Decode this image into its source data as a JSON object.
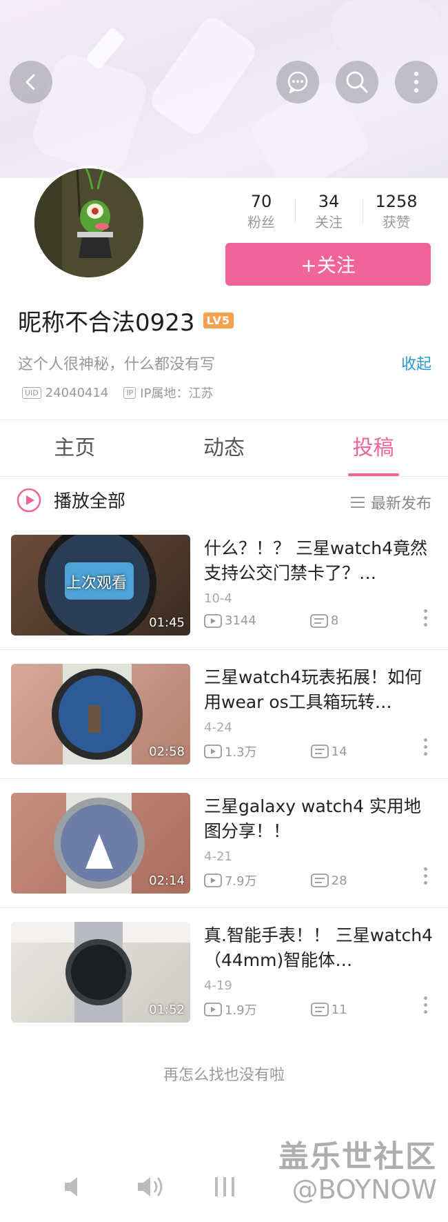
{
  "banner": {
    "back_icon": "back-arrow-icon",
    "message_icon": "chat-bubble-icon",
    "search_icon": "search-icon",
    "more_icon": "more-vertical-icon"
  },
  "profile": {
    "stats": [
      {
        "value": "70",
        "label": "粉丝"
      },
      {
        "value": "34",
        "label": "关注"
      },
      {
        "value": "1258",
        "label": "获赞"
      }
    ],
    "follow_label": "+关注",
    "nickname": "昵称不合法0923",
    "level": "LV5",
    "bio": "这个人很神秘，什么都没有写",
    "collapse_label": "收起",
    "uid_tag": "UID",
    "uid": "24040414",
    "ip_tag": "IP",
    "ip_location": "IP属地：江苏"
  },
  "tabs": [
    {
      "label": "主页",
      "active": false
    },
    {
      "label": "动态",
      "active": false
    },
    {
      "label": "投稿",
      "active": true
    }
  ],
  "list_header": {
    "play_all_label": "播放全部",
    "sort_label": "最新发布"
  },
  "videos": [
    {
      "title": "什么？！？ 三星watch4竟然支持公交门禁卡了？…",
      "duration": "01:45",
      "date": "10-4",
      "plays": "3144",
      "comments": "8",
      "overlay": "上次观看"
    },
    {
      "title": "三星watch4玩表拓展！如何用wear os工具箱玩转…",
      "duration": "02:58",
      "date": "4-24",
      "plays": "1.3万",
      "comments": "14",
      "overlay": ""
    },
    {
      "title": "三星galaxy watch4 实用地图分享！！",
      "duration": "02:14",
      "date": "4-21",
      "plays": "7.9万",
      "comments": "28",
      "overlay": ""
    },
    {
      "title": "真.智能手表！！ 三星watch4（44mm)智能体…",
      "duration": "01:52",
      "date": "4-19",
      "plays": "1.9万",
      "comments": "11",
      "overlay": ""
    }
  ],
  "end_text": "再怎么找也没有啦",
  "watermark": {
    "line1": "盖乐世社区",
    "line2": "@BOYNOW"
  },
  "colors": {
    "accent": "#f0649a",
    "link": "#2a9bd4",
    "level_badge": "#f5a150"
  }
}
